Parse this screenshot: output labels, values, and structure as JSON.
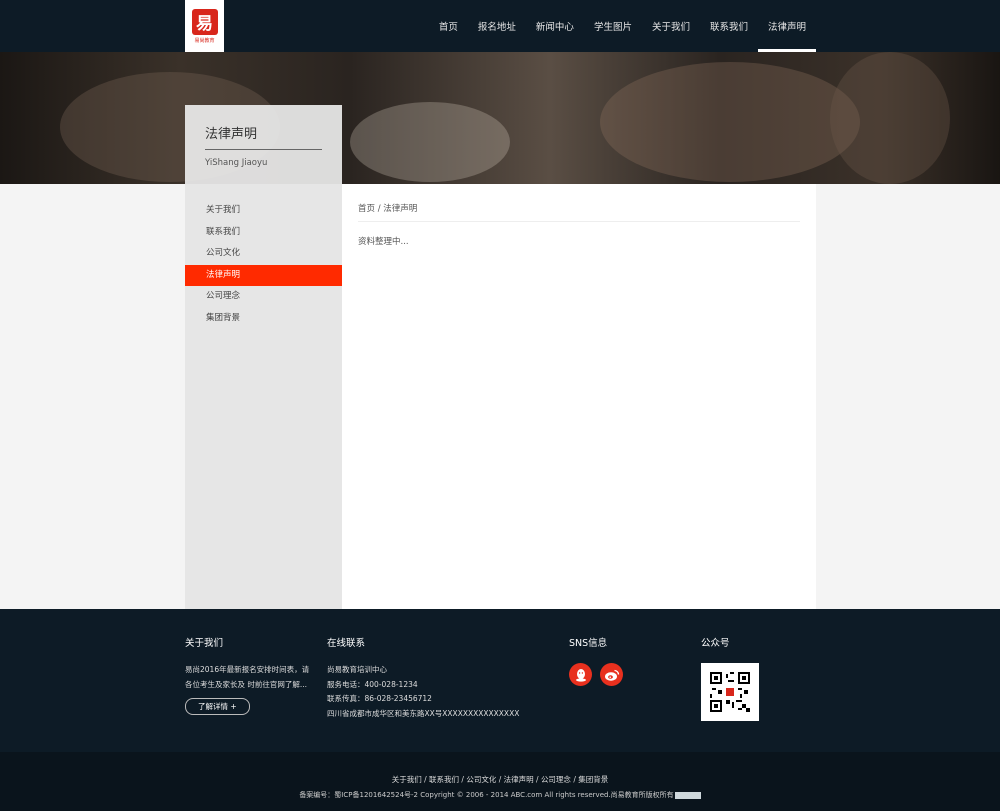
{
  "logo": {
    "mark": "易",
    "text": "易尚教育"
  },
  "nav": [
    {
      "label": "首页"
    },
    {
      "label": "报名地址"
    },
    {
      "label": "新闻中心"
    },
    {
      "label": "学生图片"
    },
    {
      "label": "关于我们"
    },
    {
      "label": "联系我们"
    },
    {
      "label": "法律声明",
      "active": true
    }
  ],
  "section": {
    "title": "法律声明",
    "subtitle": "YiShang Jiaoyu"
  },
  "sidebar": [
    {
      "label": "关于我们"
    },
    {
      "label": "联系我们"
    },
    {
      "label": "公司文化"
    },
    {
      "label": "法律声明",
      "active": true
    },
    {
      "label": "公司理念"
    },
    {
      "label": "集团背景"
    }
  ],
  "breadcrumb": {
    "home": "首页",
    "sep": "/",
    "current": "法律声明"
  },
  "content": {
    "text": "资料整理中..."
  },
  "footer": {
    "about": {
      "heading": "关于我们",
      "lines": [
        "易尚2016年最新报名安排时间表，请",
        "各位考生及家长及 时前往官网了解..."
      ],
      "more": "了解详情 +"
    },
    "contact": {
      "heading": "在线联系",
      "lines": [
        "尚易教育培训中心",
        "服务电话：400-028-1234",
        "联系传真：86-028-23456712",
        "四川省成都市成华区和美东路XX号XXXXXXXXXXXXXXX"
      ]
    },
    "sns": {
      "heading": "SNS信息"
    },
    "wechat": {
      "heading": "公众号"
    }
  },
  "bottom": {
    "links": [
      "关于我们",
      "联系我们",
      "公司文化",
      "法律声明",
      "公司理念",
      "集团背景"
    ],
    "sep": " / ",
    "copyright": "备案编号：蜀ICP备1201642524号-2 Copyright © 2006 - 2014 ABC.com All rights reserved.尚易教育所版权所有"
  },
  "colors": {
    "accent": "#ff2a00",
    "dark": "#0d1b26"
  },
  "icons": {
    "sns1": "qq-icon",
    "sns2": "weibo-icon",
    "qr": "qr-code-icon"
  }
}
